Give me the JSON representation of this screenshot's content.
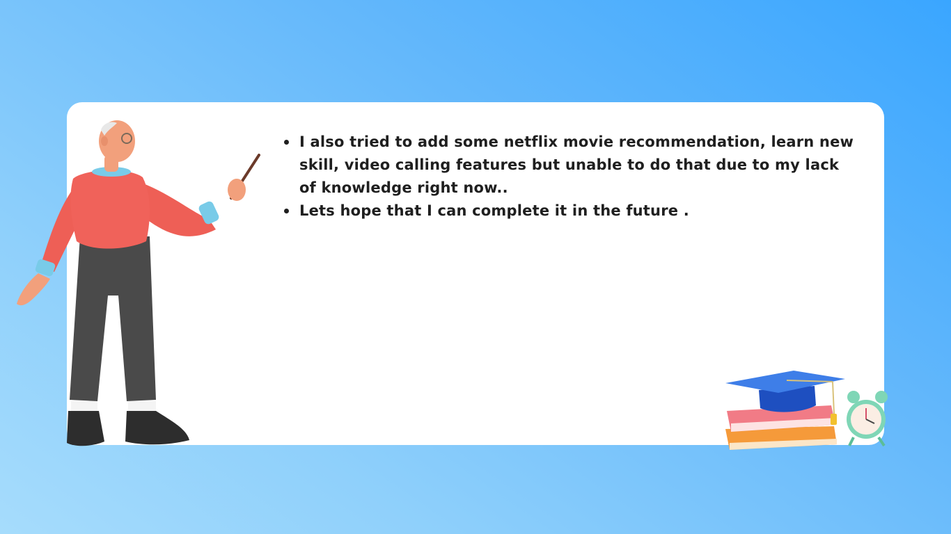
{
  "slide": {
    "bullets": [
      "I also tried to add some netflix movie recommendation, learn new skill, video calling features but unable to do that due to my lack of knowledge right now..",
      "Lets hope that I can complete it in the future ."
    ]
  },
  "illustrations": {
    "teacher": "teacher-with-pointer",
    "study": "graduation-cap-books-alarm-clock"
  },
  "colors": {
    "background_top": "#3aa6ff",
    "background_bottom": "#a6dcfc",
    "card": "#ffffff",
    "text": "#1f1f1f",
    "sweater": "#f0625a",
    "trousers": "#4a4a4a"
  }
}
